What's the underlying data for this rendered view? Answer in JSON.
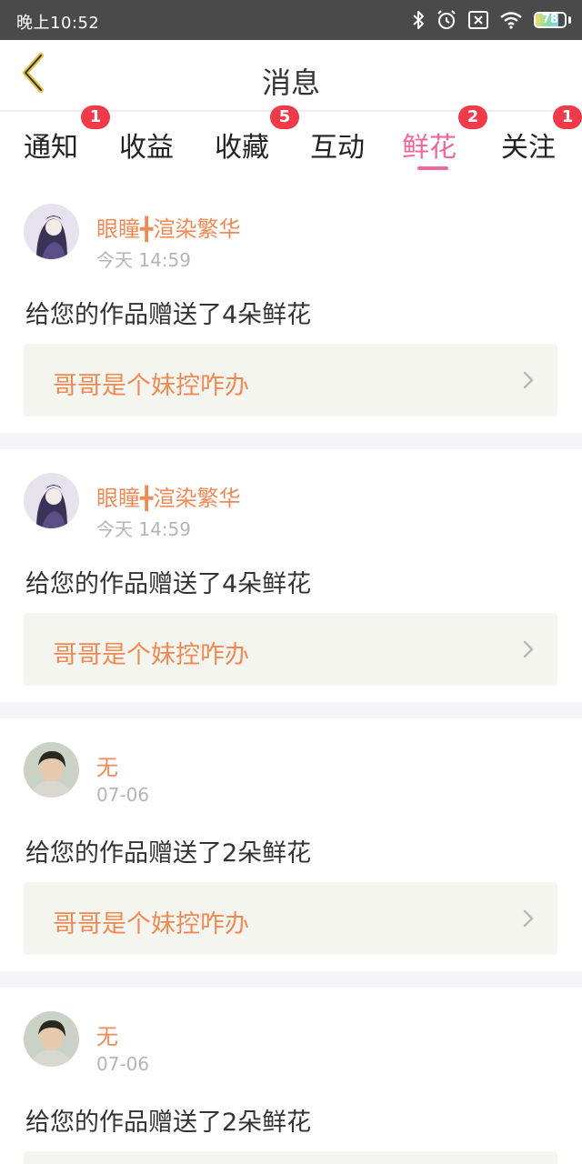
{
  "status_bar": {
    "time": "晚上10:52",
    "battery": "78",
    "battery_level": 0.78,
    "icons": [
      "bluetooth-icon",
      "alarm-icon",
      "sim-off-icon",
      "wifi-icon",
      "battery-icon"
    ]
  },
  "header": {
    "title": "消息",
    "back_icon": "chevron-left-icon"
  },
  "tabs": [
    {
      "label": "通知",
      "badge": "1",
      "active": false
    },
    {
      "label": "收益",
      "badge": "",
      "active": false
    },
    {
      "label": "收藏",
      "badge": "5",
      "active": false
    },
    {
      "label": "互动",
      "badge": "",
      "active": false
    },
    {
      "label": "鲜花",
      "badge": "2",
      "active": true
    },
    {
      "label": "关注",
      "badge": "1",
      "active": false
    }
  ],
  "feed": [
    {
      "username": "眼瞳╋渲染繁华",
      "time": "今天 14:59",
      "message": "给您的作品赠送了4朵鲜花",
      "work_title": "哥哥是个妹控咋办",
      "avatar": "avatar-girl"
    },
    {
      "username": "眼瞳╋渲染繁华",
      "time": "今天 14:59",
      "message": "给您的作品赠送了4朵鲜花",
      "work_title": "哥哥是个妹控咋办",
      "avatar": "avatar-girl"
    },
    {
      "username": "无",
      "time": "07-06",
      "message": "给您的作品赠送了2朵鲜花",
      "work_title": "哥哥是个妹控咋办",
      "avatar": "avatar-boy"
    },
    {
      "username": "无",
      "time": "07-06",
      "message": "给您的作品赠送了2朵鲜花",
      "work_title": "",
      "avatar": "avatar-boy"
    }
  ],
  "colors": {
    "accent": "#f0689a",
    "username": "#f08a55",
    "badge": "#ef3a4a",
    "status_bar": "#4a4a4a"
  }
}
